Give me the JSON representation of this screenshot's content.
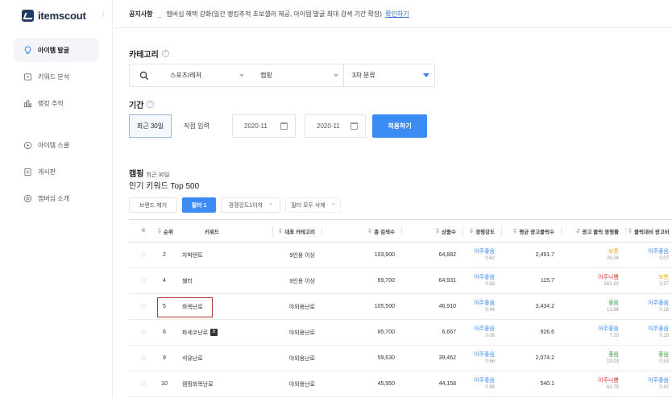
{
  "brand": {
    "name": "itemscout",
    "toggle_glyph": "⁞"
  },
  "sidebar": {
    "items": [
      {
        "label": "아이템 발굴",
        "icon": "lightbulb-icon",
        "active": true
      },
      {
        "label": "키워드 분석",
        "icon": "keyword-icon",
        "active": false
      },
      {
        "label": "랭킹 추적",
        "icon": "chart-icon",
        "active": false
      },
      {
        "label": "아이템 스쿨",
        "icon": "school-icon",
        "active": false
      },
      {
        "label": "게시판",
        "icon": "board-icon",
        "active": false
      },
      {
        "label": "멤버십 소개",
        "icon": "membership-icon",
        "active": false
      }
    ]
  },
  "notice": {
    "label": "공지사항",
    "dash": "_",
    "message": "멤버십 혜택 강화(일간 랭킹추적 초보셀러 제공, 아이템 발굴 최대 검색 기간 확장)",
    "link": "확인하기"
  },
  "category": {
    "label": "카테고리",
    "help": "?",
    "level1": "스포츠/레저",
    "level2": "캠핑",
    "level3": "3차 분류"
  },
  "period": {
    "label": "기간",
    "help": "?",
    "recent30": "최근 30일",
    "custom": "직접 입력",
    "start": "2020-11",
    "end": "2020-11",
    "apply": "적용하기"
  },
  "list": {
    "category": "캠핑",
    "subtitle": "최근 30일",
    "heading": "인기 키워드 Top 500"
  },
  "filters": {
    "brand_exclude": "브랜드 제거",
    "filter": "필터 1",
    "competition": "경쟁강도1이하",
    "competition_x": "×",
    "clear_all": "필터 모두 삭제",
    "clear_x": "×"
  },
  "table": {
    "headers": {
      "star": "★",
      "rank": "순위",
      "keyword": "키워드",
      "category": "대표 카테고리",
      "searches": "총 검색수",
      "products": "상품수",
      "competition": "경쟁강도",
      "avg_ad_clicks": "평균 광고클릭수",
      "ad_competition": "광고 클릭 경쟁률",
      "click_ratio": "클릭대비 광고비"
    },
    "rows": [
      {
        "rank": "2",
        "keyword": "차박텐트",
        "ad": false,
        "category": "9인용 이상",
        "searches": "103,900",
        "products": "64,882",
        "comp": "아주좋음",
        "comp_num": "0.62",
        "comp_color": "#3b8cf5",
        "avg_clicks": "2,491.7",
        "adcomp": "보통",
        "adcomp_num": "26.04",
        "adcomp_color": "#f5a623",
        "ratio": "아주좋음",
        "ratio_num": "0.07",
        "ratio_color": "#3b8cf5"
      },
      {
        "rank": "4",
        "keyword": "쉘터",
        "ad": false,
        "category": "9인용 이상",
        "searches": "69,700",
        "products": "64,931",
        "comp": "아주좋음",
        "comp_num": "0.93",
        "comp_color": "#3b8cf5",
        "avg_clicks": "115.7",
        "adcomp": "아주나쁨",
        "adcomp_num": "561.20",
        "adcomp_color": "#e53935",
        "ratio": "보통",
        "ratio_num": "3.57",
        "ratio_color": "#f5a623"
      },
      {
        "rank": "5",
        "keyword": "화목난로",
        "ad": false,
        "category": "야외용난로",
        "searches": "105,500",
        "products": "46,910",
        "comp": "아주좋음",
        "comp_num": "0.44",
        "comp_color": "#3b8cf5",
        "avg_clicks": "3,434.2",
        "adcomp": "좋음",
        "adcomp_num": "13.66",
        "adcomp_color": "#43a047",
        "ratio": "아주좋음",
        "ratio_num": "0.16",
        "ratio_color": "#3b8cf5"
      },
      {
        "rank": "6",
        "keyword": "파세코난로",
        "ad": true,
        "ad_label": "B",
        "category": "야외용난로",
        "searches": "85,700",
        "products": "6,667",
        "comp": "아주좋음",
        "comp_num": "0.08",
        "comp_color": "#3b8cf5",
        "avg_clicks": "926.6",
        "adcomp": "아주좋음",
        "adcomp_num": "7.20",
        "adcomp_color": "#3b8cf5",
        "ratio": "아주좋음",
        "ratio_num": "0.19",
        "ratio_color": "#3b8cf5"
      },
      {
        "rank": "9",
        "keyword": "석유난로",
        "ad": false,
        "category": "야외용난로",
        "searches": "59,630",
        "products": "39,462",
        "comp": "아주좋음",
        "comp_num": "0.66",
        "comp_color": "#3b8cf5",
        "avg_clicks": "2,074.2",
        "adcomp": "좋음",
        "adcomp_num": "19.03",
        "adcomp_color": "#43a047",
        "ratio": "좋음",
        "ratio_num": "0.53",
        "ratio_color": "#43a047"
      },
      {
        "rank": "10",
        "keyword": "캠핑화목난로",
        "ad": false,
        "category": "야외용난로",
        "searches": "45,950",
        "products": "44,158",
        "comp": "아주좋음",
        "comp_num": "0.96",
        "comp_color": "#3b8cf5",
        "avg_clicks": "540.1",
        "adcomp": "아주나쁨",
        "adcomp_num": "81.76",
        "adcomp_color": "#e53935",
        "ratio": "아주좋음",
        "ratio_num": "0.42",
        "ratio_color": "#3b8cf5"
      }
    ]
  }
}
